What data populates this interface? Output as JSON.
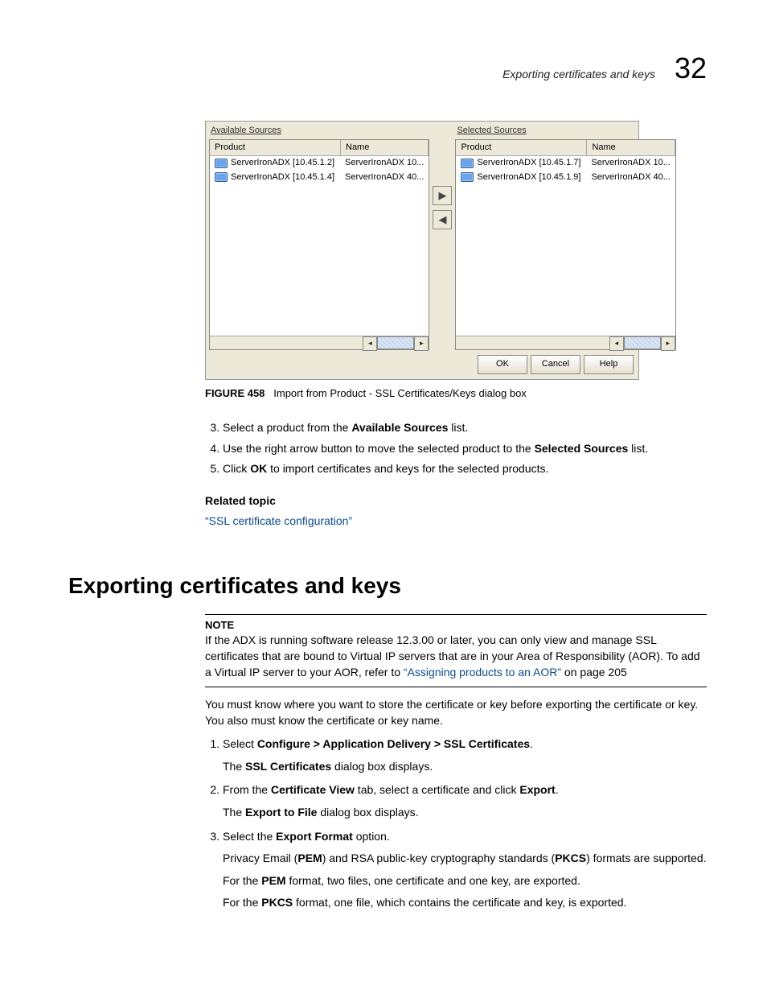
{
  "header": {
    "title": "Exporting certificates and keys",
    "chapter": "32"
  },
  "dialog": {
    "available_label": "Available Sources",
    "selected_label": "Selected Sources",
    "col_product": "Product",
    "col_name": "Name",
    "available_rows": [
      {
        "product": "ServerIronADX [10.45.1.2]",
        "name": "ServerIronADX 10..."
      },
      {
        "product": "ServerIronADX [10.45.1.4]",
        "name": "ServerIronADX 40..."
      }
    ],
    "selected_rows": [
      {
        "product": "ServerIronADX [10.45.1.7]",
        "name": "ServerIronADX 10..."
      },
      {
        "product": "ServerIronADX [10.45.1.9]",
        "name": "ServerIronADX 40..."
      }
    ],
    "move_right": "▶",
    "move_left": "◀",
    "ok": "OK",
    "cancel": "Cancel",
    "help": "Help"
  },
  "caption": {
    "label": "FIGURE 458",
    "text": "Import from Product - SSL Certificates/Keys dialog box"
  },
  "steps_a": {
    "start": 3,
    "items": [
      {
        "pre": "Select a product from the ",
        "bold": "Available Sources",
        "post": " list."
      },
      {
        "pre": "Use the right arrow button to move the selected product to the ",
        "bold": "Selected Sources",
        "post": " list."
      },
      {
        "pre": "Click ",
        "bold": "OK",
        "post": " to import certificates and keys for the selected products."
      }
    ]
  },
  "related": {
    "heading": "Related topic",
    "link": "“SSL certificate configuration”"
  },
  "section_h1": "Exporting certificates and keys",
  "note": {
    "label": "NOTE",
    "text1": "If the ADX is running software release 12.3.00 or later, you can only view and manage SSL certificates that are bound to Virtual IP servers that are in your Area of Responsibility (AOR). To add a Virtual IP server to your AOR, refer to ",
    "link": "“Assigning products to an AOR”",
    "text2": " on page 205"
  },
  "intro_para": "You must know where you want to store the certificate or key before exporting the certificate or key. You also must know the certificate or key name.",
  "steps_b": [
    {
      "pre": "Select ",
      "bold": "Configure > Application Delivery > SSL Certificates",
      "post1": ".",
      "sub_pre": "The ",
      "sub_bold": "SSL Certificates",
      "sub_post": " dialog box displays."
    },
    {
      "pre": "From the ",
      "bold": "Certificate View",
      "mid": " tab, select a certificate and click ",
      "bold2": "Export",
      "post": ".",
      "sub_pre": "The ",
      "sub_bold": "Export to File",
      "sub_post": " dialog box displays."
    },
    {
      "pre": "Select the ",
      "bold": "Export Format",
      "post": " option.",
      "subs": [
        {
          "pre": "Privacy Email (",
          "b1": "PEM",
          "mid": ") and RSA public-key cryptography standards (",
          "b2": "PKCS",
          "post": ") formats are supported."
        },
        {
          "pre": "For the ",
          "b1": "PEM",
          "post": " format, two files, one certificate and one key, are exported."
        },
        {
          "pre": "For the ",
          "b1": "PKCS",
          "post": " format, one file, which contains the certificate and key, is exported."
        }
      ]
    }
  ]
}
